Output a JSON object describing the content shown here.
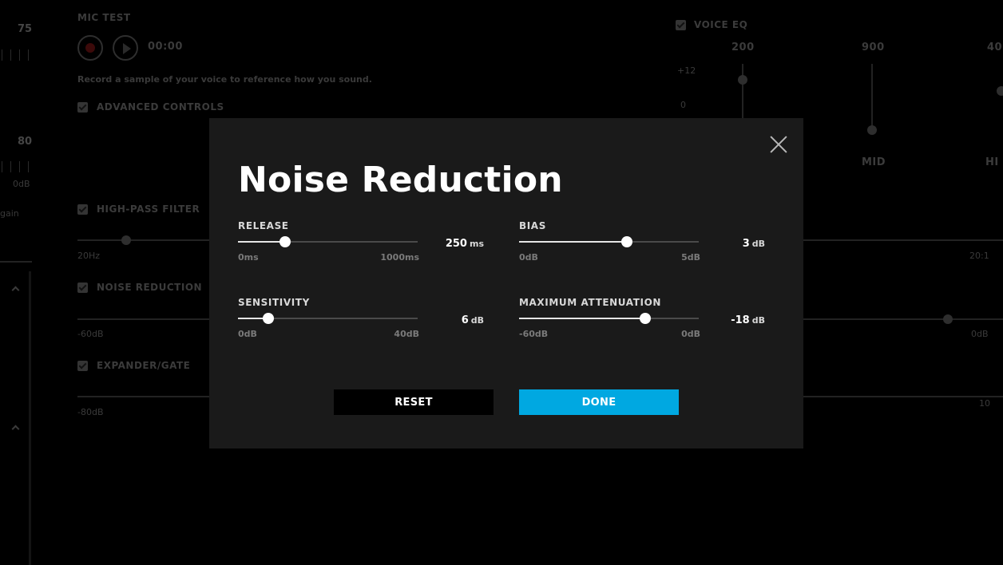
{
  "background": {
    "mic_test": {
      "heading": "MIC TEST",
      "time": "00:00",
      "description": "Record a sample of your voice to reference how you sound."
    },
    "advanced_controls_label": "ADVANCED CONTROLS",
    "high_pass_filter_label": "HIGH-PASS FILTER",
    "noise_reduction_label": "NOISE REDUCTION",
    "expander_gate_label": "EXPANDER/GATE",
    "left_values": {
      "top": "75",
      "middle": "80",
      "db": "0dB",
      "gain": "gain"
    },
    "hpf_min": "20Hz",
    "hpf_max": "20:1",
    "nr_min": "-60dB",
    "nr_max": "0dB",
    "gate_min": "-80dB",
    "gate_max": "10",
    "voice_eq": {
      "label": "VOICE EQ",
      "freqs": [
        "200",
        "900",
        "40"
      ],
      "db_labels": [
        "+12",
        "0"
      ],
      "bands": [
        "MID",
        "HI"
      ]
    }
  },
  "modal": {
    "title": "Noise Reduction",
    "controls": [
      {
        "label": "RELEASE",
        "value": "250",
        "unit": "ms",
        "min_label": "0ms",
        "max_label": "1000ms",
        "fraction": 0.26
      },
      {
        "label": "BIAS",
        "value": "3",
        "unit": "dB",
        "min_label": "0dB",
        "max_label": "5dB",
        "fraction": 0.6
      },
      {
        "label": "SENSITIVITY",
        "value": "6",
        "unit": "dB",
        "min_label": "0dB",
        "max_label": "40dB",
        "fraction": 0.17
      },
      {
        "label": "MAXIMUM ATTENUATION",
        "value": "-18",
        "unit": "dB",
        "min_label": "-60dB",
        "max_label": "0dB",
        "fraction": 0.7
      }
    ],
    "reset_label": "RESET",
    "done_label": "DONE"
  },
  "colors": {
    "accent": "#00a8e1",
    "modal_bg": "#1a1a1a",
    "page_bg": "#000000"
  }
}
